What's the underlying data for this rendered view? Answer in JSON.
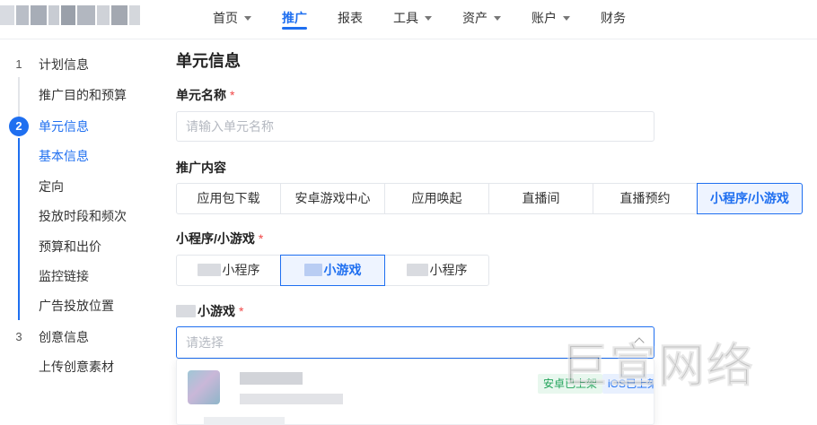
{
  "nav": {
    "items": [
      {
        "label": "首页",
        "dropdown": true,
        "active": false
      },
      {
        "label": "推广",
        "dropdown": false,
        "active": true
      },
      {
        "label": "报表",
        "dropdown": false,
        "active": false
      },
      {
        "label": "工具",
        "dropdown": true,
        "active": false
      },
      {
        "label": "资产",
        "dropdown": true,
        "active": false
      },
      {
        "label": "账户",
        "dropdown": true,
        "active": false
      },
      {
        "label": "财务",
        "dropdown": false,
        "active": false
      }
    ]
  },
  "sidebar": {
    "step1": {
      "num": "1",
      "label": "计划信息"
    },
    "step1_sub": [
      "推广目的和预算"
    ],
    "step2": {
      "num": "2",
      "label": "单元信息"
    },
    "step2_sub": [
      "基本信息",
      "定向",
      "投放时段和频次",
      "预算和出价",
      "监控链接",
      "广告投放位置"
    ],
    "step3": {
      "num": "3",
      "label": "创意信息"
    },
    "step3_sub": [
      "上传创意素材"
    ]
  },
  "main": {
    "section_title": "单元信息",
    "unit_name": {
      "label": "单元名称",
      "required": "*",
      "placeholder": "请输入单元名称"
    },
    "promo_content": {
      "label": "推广内容",
      "options": [
        "应用包下载",
        "安卓游戏中心",
        "应用唤起",
        "直播间",
        "直播预约",
        "小程序/小游戏"
      ],
      "selected": "小程序/小游戏"
    },
    "miniprogram": {
      "label": "小程序/小游戏",
      "required": "*",
      "options": [
        "小程序",
        "小游戏",
        "小程序"
      ],
      "selected_index": 1
    },
    "minigame": {
      "label": "小游戏",
      "required": "*",
      "placeholder": "请选择"
    },
    "dropdown": {
      "badge_android": "安卓已上架",
      "badge_ios": "iOS已上架"
    }
  },
  "watermark": "巨宣网络",
  "colors": {
    "accent": "#1f6ff0",
    "required": "#f04848",
    "android_badge": "#21a35a"
  }
}
